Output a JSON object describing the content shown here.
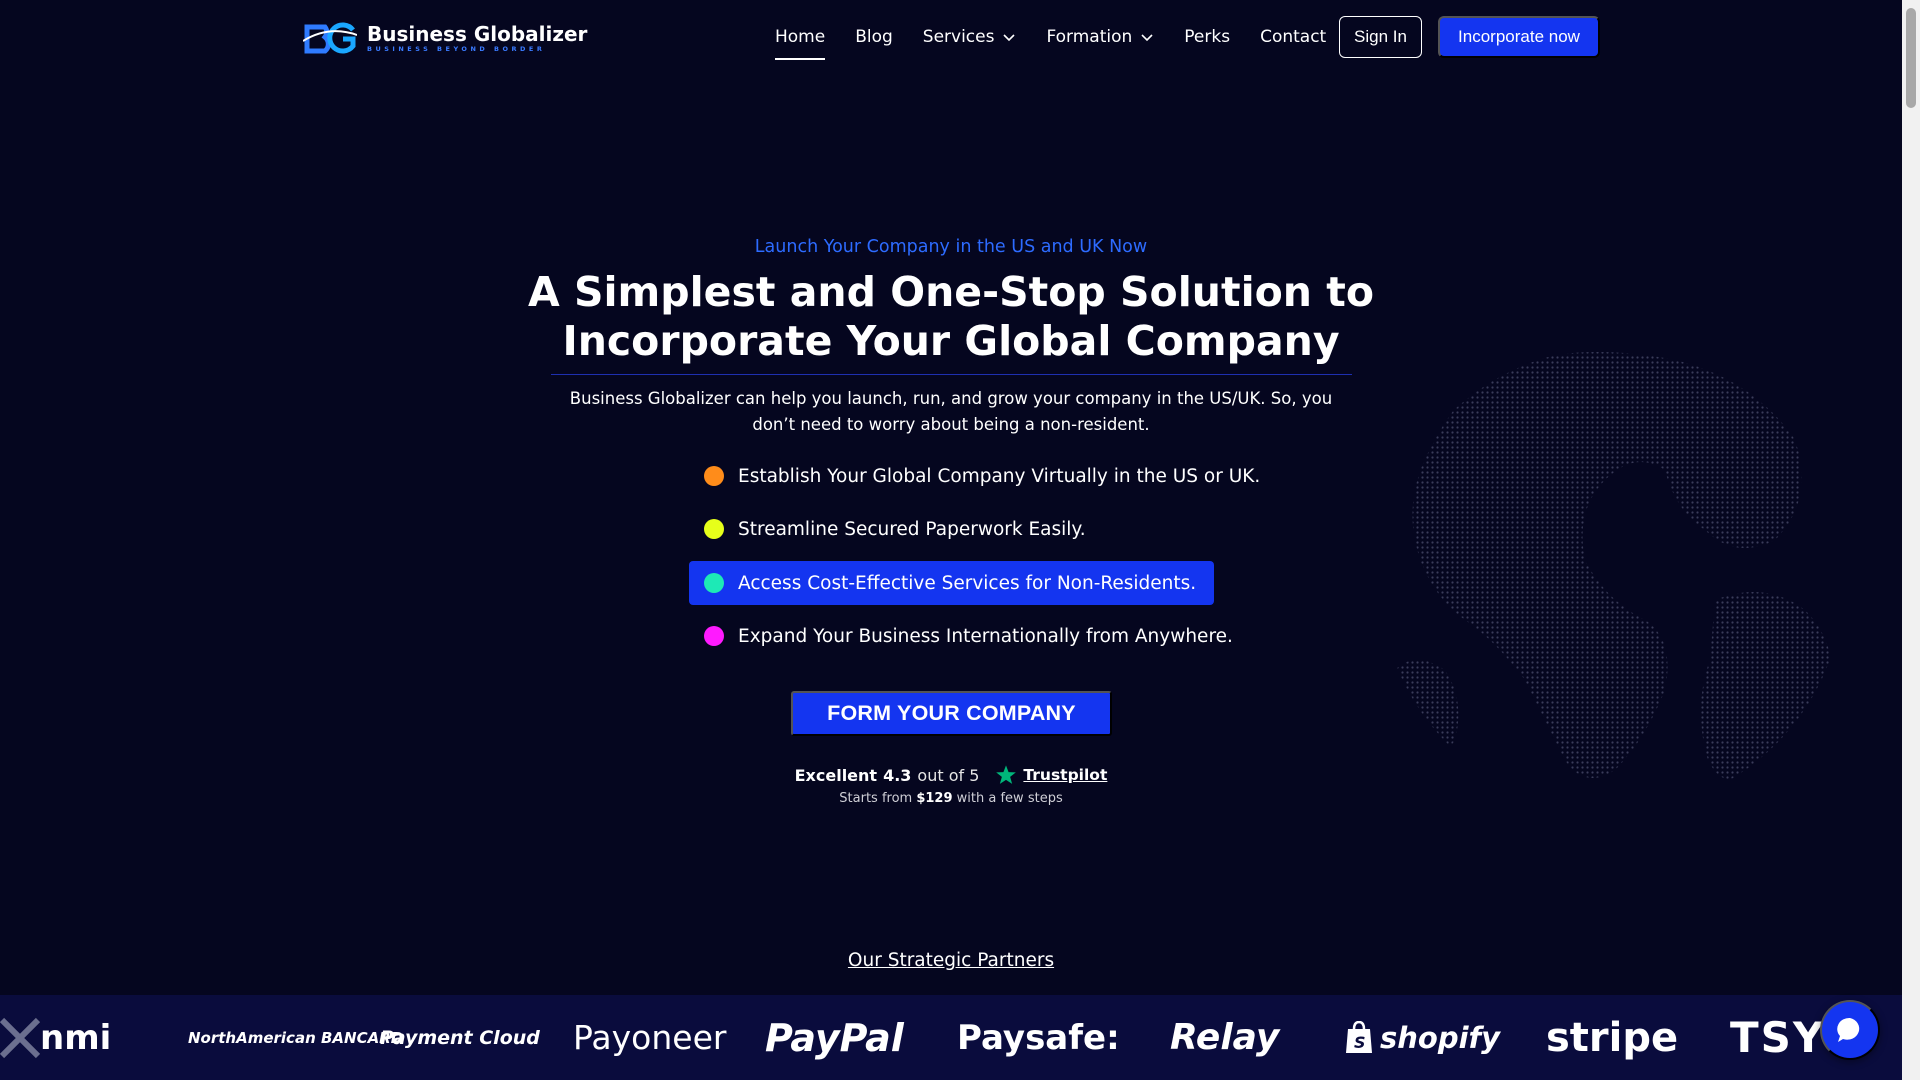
{
  "header": {
    "logo_mark": "BG",
    "logo_name": "Business Globalizer",
    "logo_tagline": "BUSINESS BEYOND BORDER",
    "nav": [
      {
        "label": "Home",
        "active": true,
        "dropdown": false
      },
      {
        "label": "Blog",
        "active": false,
        "dropdown": false
      },
      {
        "label": "Services",
        "active": false,
        "dropdown": true
      },
      {
        "label": "Formation",
        "active": false,
        "dropdown": true
      },
      {
        "label": "Perks",
        "active": false,
        "dropdown": false
      },
      {
        "label": "Contact",
        "active": false,
        "dropdown": false
      }
    ],
    "signin_label": "Sign In",
    "incorporate_label": "Incorporate now"
  },
  "hero": {
    "eyebrow": "Launch Your Company in the US and UK Now",
    "headline_line1": "A Simplest and One-Stop Solution to",
    "headline_line2": "Incorporate Your Global Company",
    "lead": "Business Globalizer can help you launch, run, and grow your company in the US/UK. So, you don’t need to worry about being a non-resident.",
    "bullets": [
      {
        "text": "Establish Your Global Company Virtually in the US or UK.",
        "color": "#ff8c1a",
        "highlight": false
      },
      {
        "text": "Streamline Secured Paperwork Easily.",
        "color": "#e6ff1a",
        "highlight": false
      },
      {
        "text": "Access Cost-Effective Services for Non-Residents.",
        "color": "#1de9b6",
        "highlight": true
      },
      {
        "text": "Expand Your Business Internationally from Anywhere.",
        "color": "#ff1aff",
        "highlight": false
      }
    ],
    "cta_label": "FORM YOUR COMPANY",
    "rating": {
      "word": "Excellent",
      "score": "4.3",
      "out_of": "out of 5",
      "provider": "Trustpilot",
      "star_color": "#00b67a"
    },
    "price_prefix": "Starts from",
    "price_value": "$129",
    "price_suffix": "with a few steps"
  },
  "partners": {
    "title": "Our Strategic Partners",
    "logos": [
      "nmi",
      "NorthAmerican BANCARD",
      "Payment Cloud",
      "Payoneer",
      "PayPal",
      "Paysafe:",
      "Relay",
      "shopify",
      "stripe",
      "TSYS"
    ]
  },
  "colors": {
    "background": "#05061f",
    "accent": "#1435f0",
    "eyebrow": "#2d6bff"
  },
  "icons": {
    "chevron": "chevron-down-icon",
    "chat": "chat-bubble-icon",
    "star": "star-icon",
    "globe": "globe-illustration"
  }
}
